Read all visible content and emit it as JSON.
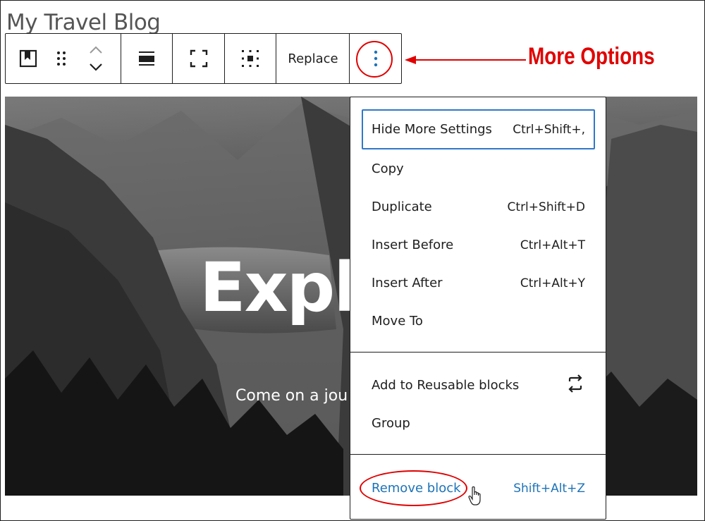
{
  "page": {
    "title": "My Travel Blog"
  },
  "toolbar": {
    "replace_label": "Replace",
    "buttons": [
      "cover-block-icon",
      "drag-handle-icon",
      "move-up-icon",
      "move-down-icon",
      "align-icon",
      "fullscreen-icon",
      "content-position-icon",
      "more-options-icon"
    ]
  },
  "cover": {
    "heading": "Expl",
    "subtitle": "Come on a jou"
  },
  "annotation": {
    "label": "More Options",
    "color": "#e00000"
  },
  "menu": {
    "section1": [
      {
        "label": "Hide More Settings",
        "shortcut": "Ctrl+Shift+,"
      },
      {
        "label": "Copy",
        "shortcut": ""
      },
      {
        "label": "Duplicate",
        "shortcut": "Ctrl+Shift+D"
      },
      {
        "label": "Insert Before",
        "shortcut": "Ctrl+Alt+T"
      },
      {
        "label": "Insert After",
        "shortcut": "Ctrl+Alt+Y"
      },
      {
        "label": "Move To",
        "shortcut": ""
      }
    ],
    "section2": [
      {
        "label": "Add to Reusable blocks",
        "icon": "reusable-block-icon"
      },
      {
        "label": "Group"
      }
    ],
    "section3": [
      {
        "label": "Remove block",
        "shortcut": "Shift+Alt+Z"
      }
    ],
    "focus_color": "#2f78c8",
    "danger_color": "#1d73b8"
  }
}
